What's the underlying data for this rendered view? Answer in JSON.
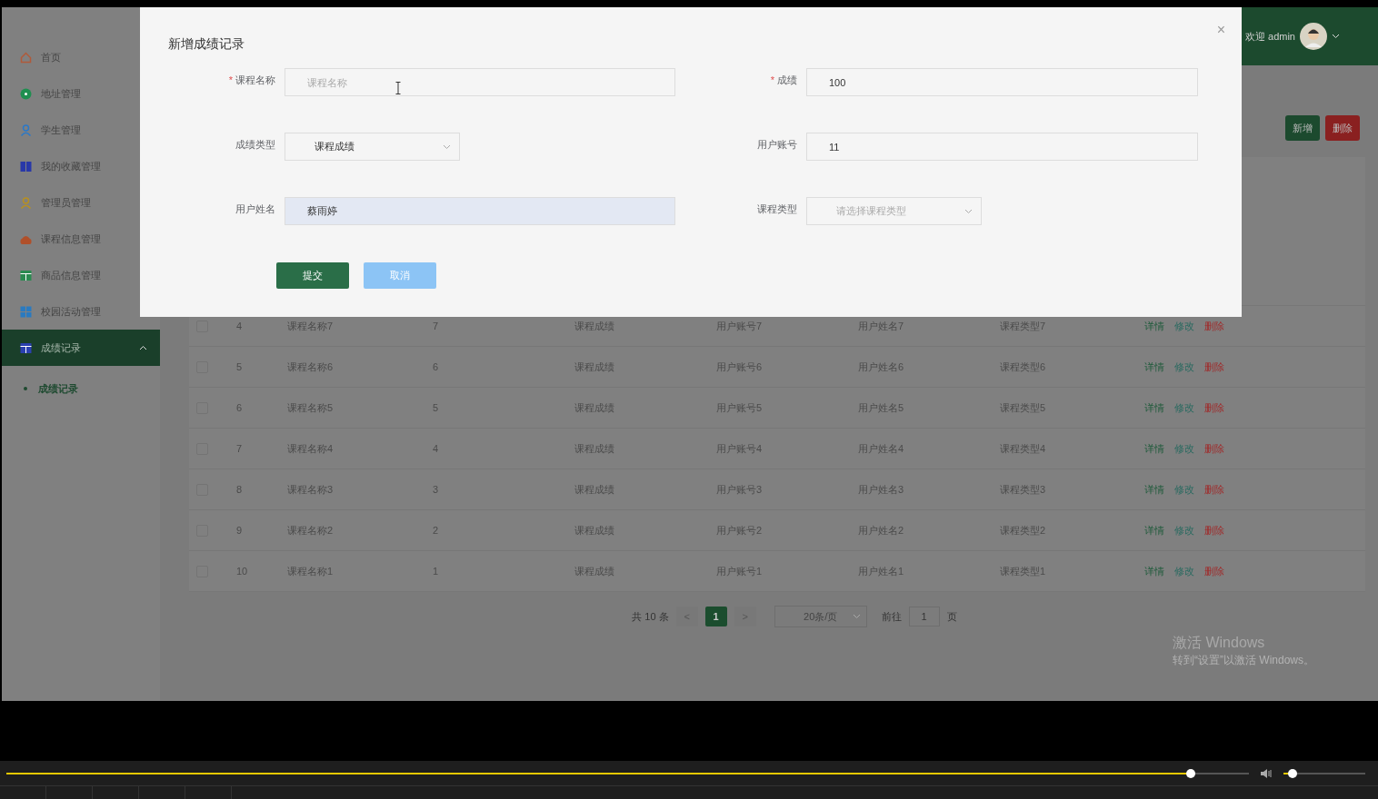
{
  "sidebar": {
    "items": [
      {
        "label": "首页",
        "kind": "home",
        "color": "#b05a3a",
        "selected": false
      },
      {
        "label": "地址管理",
        "kind": "dot",
        "color": "#1f8f50",
        "selected": false
      },
      {
        "label": "学生管理",
        "kind": "person",
        "color": "#2a78c8",
        "selected": false
      },
      {
        "label": "我的收藏管理",
        "kind": "book",
        "color": "#2838a8",
        "selected": false
      },
      {
        "label": "管理员管理",
        "kind": "person",
        "color": "#b89020",
        "selected": false
      },
      {
        "label": "课程信息管理",
        "kind": "hat",
        "color": "#b0502a",
        "selected": false
      },
      {
        "label": "商品信息管理",
        "kind": "table",
        "color": "#2a8a50",
        "selected": false
      },
      {
        "label": "校园活动管理",
        "kind": "grid",
        "color": "#2a7ac0",
        "selected": false
      },
      {
        "label": "成绩记录",
        "kind": "table",
        "color": "#2a40b0",
        "selected": true,
        "expanded": true,
        "children": [
          {
            "label": "成绩记录",
            "selected": true
          }
        ]
      }
    ]
  },
  "header": {
    "welcome": "欢迎 admin"
  },
  "toolbar": {
    "buttons": [
      {
        "label": "新增",
        "kind": "add"
      },
      {
        "label": "删除",
        "kind": "delete"
      }
    ]
  },
  "table": {
    "rows": [
      {
        "checked": false,
        "index": "4",
        "course_name": "课程名称7",
        "score": "7",
        "score_type": "课程成绩",
        "account": "用户账号7",
        "user_name": "用户姓名7",
        "course_type": "课程类型7",
        "actions": [
          "详情",
          "修改",
          "删除"
        ]
      },
      {
        "checked": false,
        "index": "5",
        "course_name": "课程名称6",
        "score": "6",
        "score_type": "课程成绩",
        "account": "用户账号6",
        "user_name": "用户姓名6",
        "course_type": "课程类型6",
        "actions": [
          "详情",
          "修改",
          "删除"
        ]
      },
      {
        "checked": false,
        "index": "6",
        "course_name": "课程名称5",
        "score": "5",
        "score_type": "课程成绩",
        "account": "用户账号5",
        "user_name": "用户姓名5",
        "course_type": "课程类型5",
        "actions": [
          "详情",
          "修改",
          "删除"
        ]
      },
      {
        "checked": false,
        "index": "7",
        "course_name": "课程名称4",
        "score": "4",
        "score_type": "课程成绩",
        "account": "用户账号4",
        "user_name": "用户姓名4",
        "course_type": "课程类型4",
        "actions": [
          "详情",
          "修改",
          "删除"
        ]
      },
      {
        "checked": false,
        "index": "8",
        "course_name": "课程名称3",
        "score": "3",
        "score_type": "课程成绩",
        "account": "用户账号3",
        "user_name": "用户姓名3",
        "course_type": "课程类型3",
        "actions": [
          "详情",
          "修改",
          "删除"
        ]
      },
      {
        "checked": false,
        "index": "9",
        "course_name": "课程名称2",
        "score": "2",
        "score_type": "课程成绩",
        "account": "用户账号2",
        "user_name": "用户姓名2",
        "course_type": "课程类型2",
        "actions": [
          "详情",
          "修改",
          "删除"
        ]
      },
      {
        "checked": false,
        "index": "10",
        "course_name": "课程名称1",
        "score": "1",
        "score_type": "课程成绩",
        "account": "用户账号1",
        "user_name": "用户姓名1",
        "course_type": "课程类型1",
        "actions": [
          "详情",
          "修改",
          "删除"
        ]
      }
    ]
  },
  "pagination": {
    "total": "共 10 条",
    "prev": "<",
    "pages": [
      {
        "label": "1",
        "selected": true
      }
    ],
    "next": ">",
    "page_size": "20条/页",
    "goto_label": "前往",
    "goto_value": "1",
    "goto_suffix": "页"
  },
  "dialog": {
    "title": "新增成绩记录",
    "close": "×",
    "required_mark": "*",
    "fields": [
      {
        "label": "课程名称",
        "required": true,
        "kind": "input",
        "placeholder": "课程名称",
        "autofilled": false
      },
      {
        "label": "成绩",
        "required": true,
        "kind": "input",
        "value": "100",
        "autofilled": false
      },
      {
        "label": "成绩类型",
        "required": false,
        "kind": "select",
        "value": "课程成绩"
      },
      {
        "label": "用户账号",
        "required": false,
        "kind": "input",
        "value": "11",
        "autofilled": false
      },
      {
        "label": "用户姓名",
        "required": false,
        "kind": "input",
        "value": "蔡雨婷",
        "autofilled": true
      },
      {
        "label": "课程类型",
        "required": false,
        "kind": "select",
        "placeholder": "请选择课程类型"
      }
    ],
    "buttons": [
      {
        "label": "提交",
        "kind": "primary"
      },
      {
        "label": "取消",
        "kind": "cancel"
      }
    ]
  },
  "os_notice": {
    "title": "激活 Windows",
    "text": "转到“设置”以激活 Windows。"
  },
  "player": {
    "progress": {
      "level": 0.953
    },
    "volume": {
      "level": 0.11
    }
  }
}
